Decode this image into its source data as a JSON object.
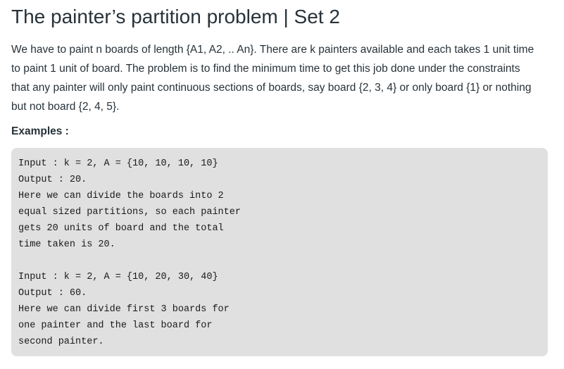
{
  "article": {
    "title": "The painter’s partition problem | Set 2",
    "intro_lines": [
      "We have to paint n boards of length {A1, A2, .. An}. There are k painters available and each takes 1 unit time",
      "to paint 1 unit of board. The problem is to find the minimum time to get this job done under the constraints",
      "that any painter will only paint continuous sections of boards, say board {2, 3, 4} or only board {1} or nothing",
      "but not board {2, 4, 5}."
    ],
    "examples_heading": "Examples :",
    "code_lines": [
      "Input : k = 2, A = {10, 10, 10, 10}",
      "Output : 20.",
      "Here we can divide the boards into 2",
      "equal sized partitions, so each painter",
      "gets 20 units of board and the total",
      "time taken is 20.",
      "",
      "Input : k = 2, A = {10, 20, 30, 40}",
      "Output : 60.",
      "Here we can divide first 3 boards for",
      "one painter and the last board for",
      "second painter."
    ]
  },
  "colors": {
    "text": "#273239",
    "code_background": "#e0e0e0",
    "page_background": "#ffffff"
  }
}
